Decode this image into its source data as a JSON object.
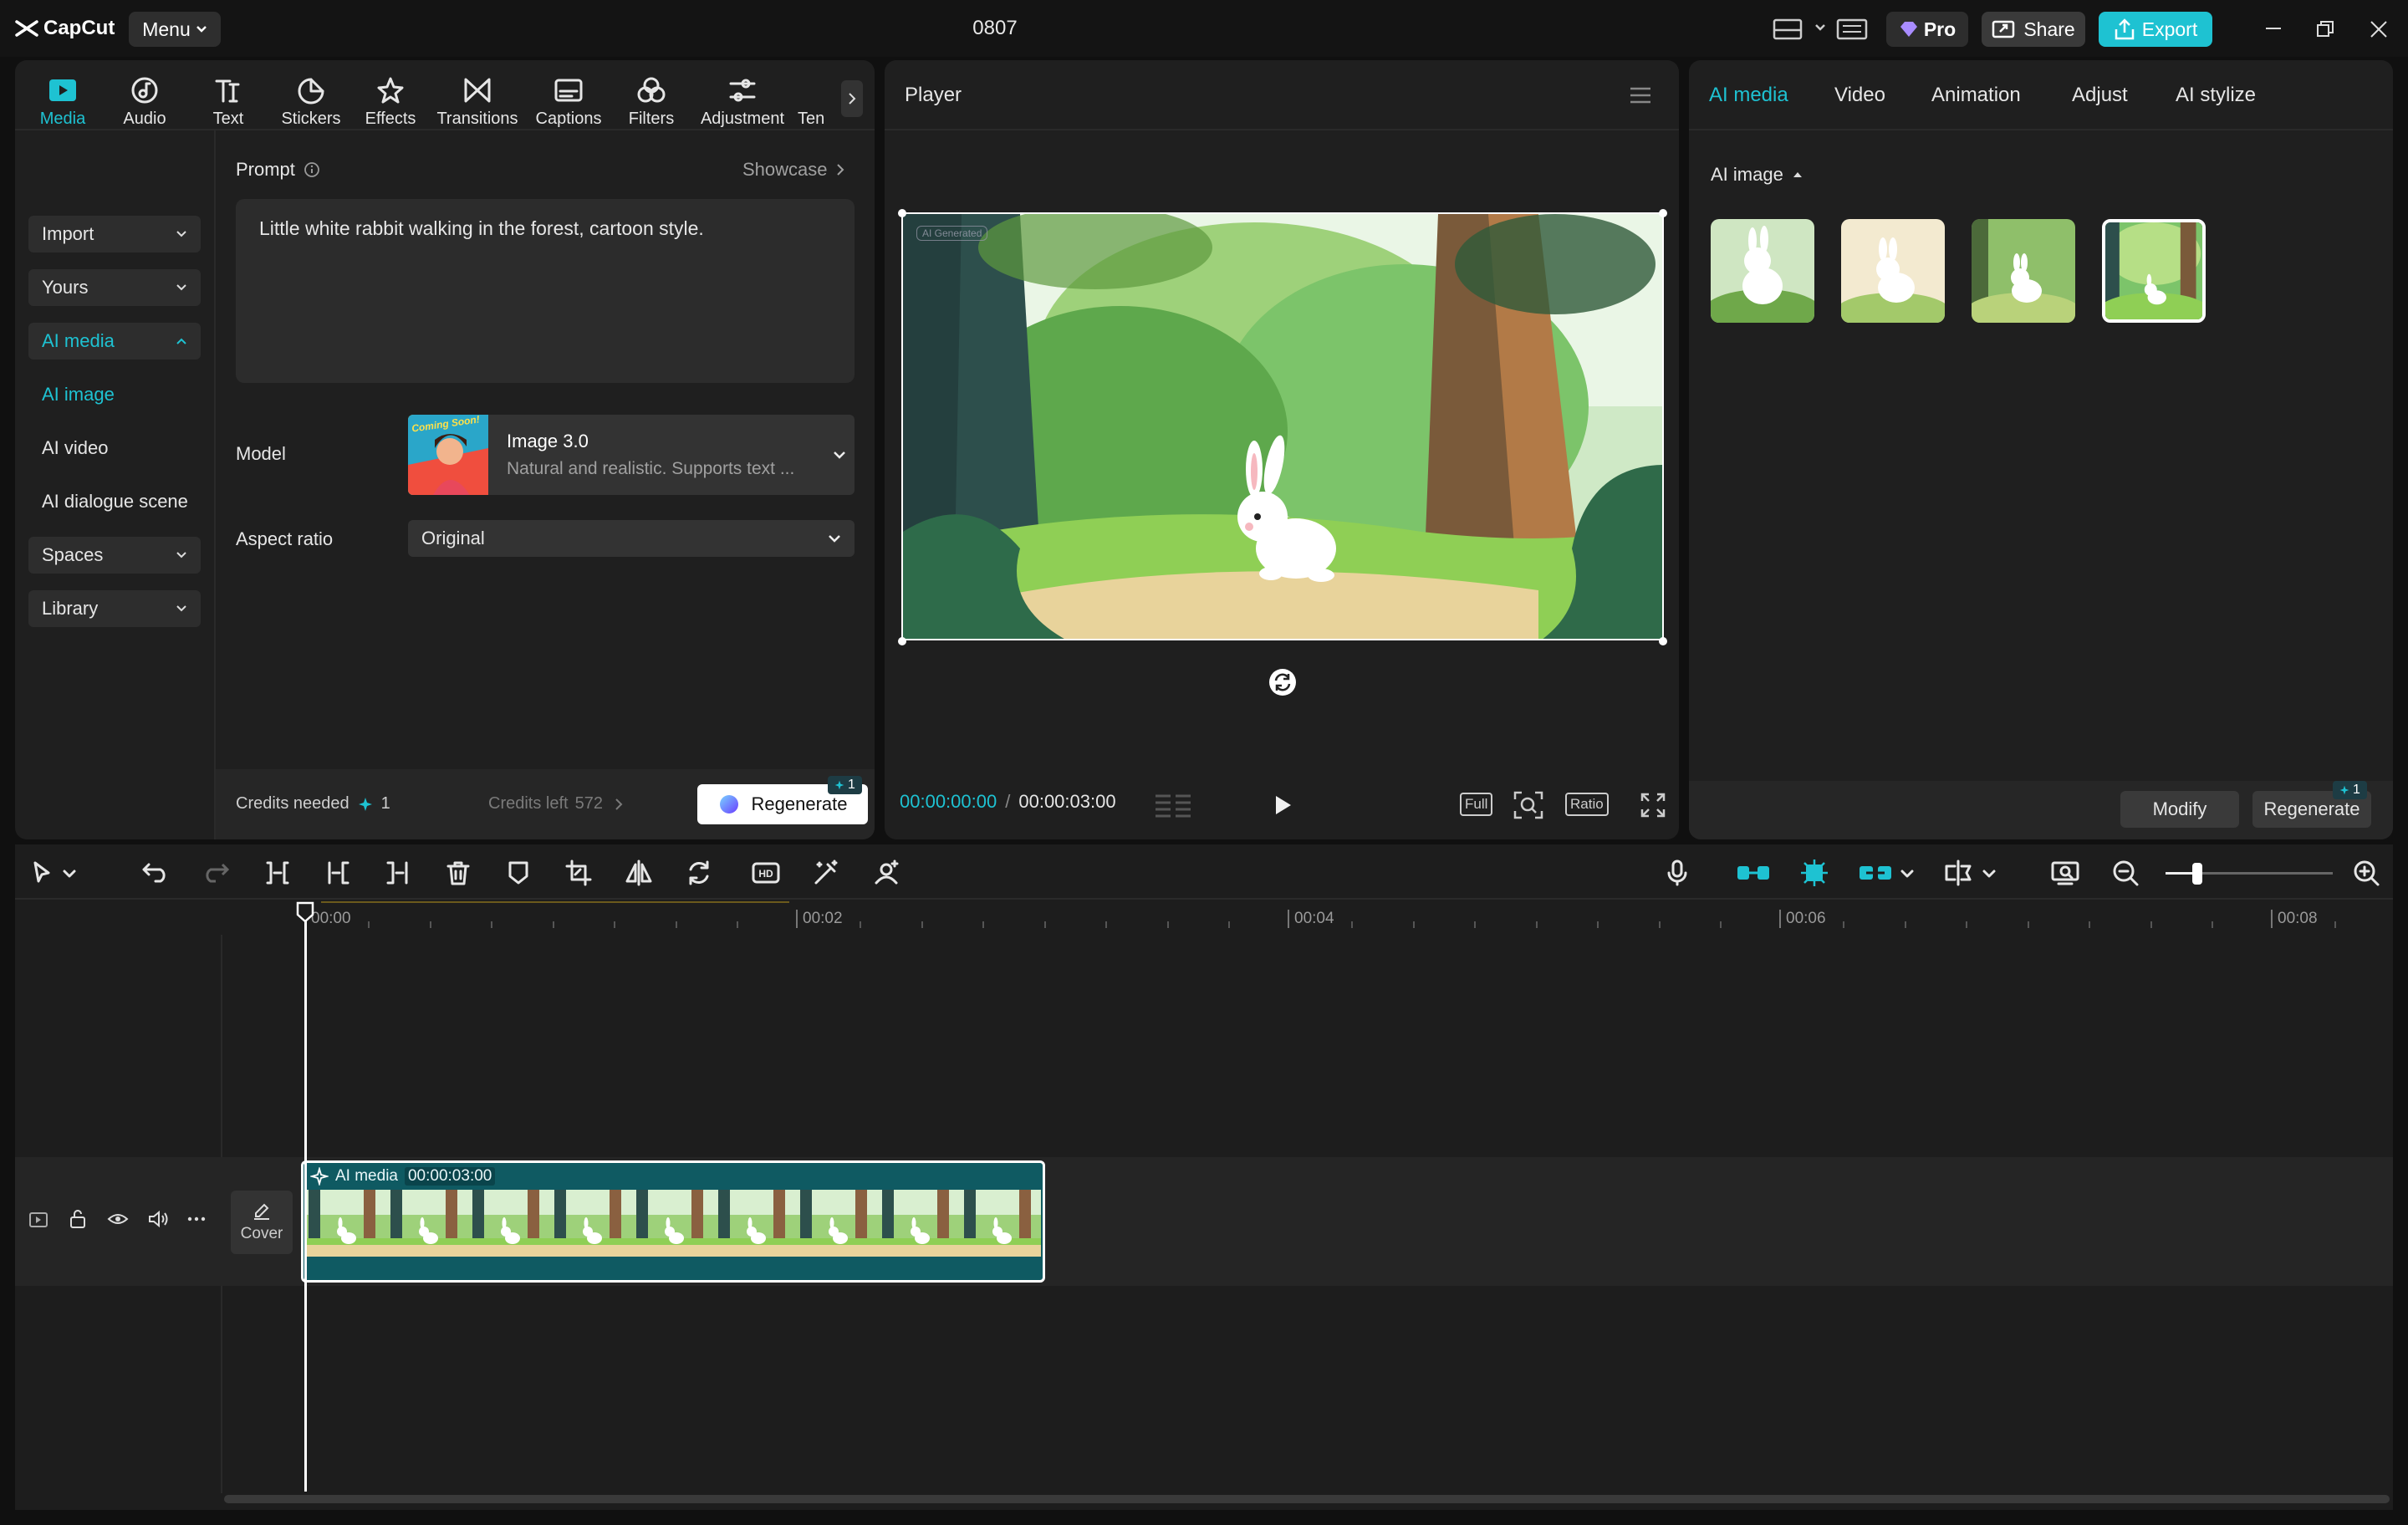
{
  "titlebar": {
    "app_name": "CapCut",
    "menu_label": "Menu",
    "project_title": "0807",
    "pro_label": "Pro",
    "share_label": "Share",
    "export_label": "Export"
  },
  "toolbar": {
    "tabs": [
      {
        "label": "Media",
        "icon": "media-icon",
        "active": true
      },
      {
        "label": "Audio",
        "icon": "audio-icon"
      },
      {
        "label": "Text",
        "icon": "text-icon"
      },
      {
        "label": "Stickers",
        "icon": "stickers-icon"
      },
      {
        "label": "Effects",
        "icon": "effects-icon"
      },
      {
        "label": "Transitions",
        "icon": "transitions-icon"
      },
      {
        "label": "Captions",
        "icon": "captions-icon"
      },
      {
        "label": "Filters",
        "icon": "filters-icon"
      },
      {
        "label": "Adjustment",
        "icon": "adjustment-icon"
      },
      {
        "label": "Ten",
        "icon": "templates-icon"
      }
    ]
  },
  "media_sidebar": {
    "import": "Import",
    "yours": "Yours",
    "ai_media": "AI media",
    "ai_image": "AI image",
    "ai_video": "AI video",
    "ai_dialogue": "AI dialogue scene",
    "spaces": "Spaces",
    "library": "Library"
  },
  "prompt_panel": {
    "prompt_label": "Prompt",
    "showcase_label": "Showcase",
    "prompt_text": "Little white rabbit walking in the forest, cartoon style.",
    "model_label": "Model",
    "model_badge": "Coming Soon!",
    "model_name": "Image 3.0",
    "model_desc": "Natural and realistic. Supports text ...",
    "aspect_label": "Aspect ratio",
    "aspect_value": "Original",
    "credits_needed_label": "Credits needed",
    "credits_needed_value": "1",
    "credits_left_label": "Credits left",
    "credits_left_value": "572",
    "regenerate_label": "Regenerate",
    "regenerate_badge": "1"
  },
  "player": {
    "title": "Player",
    "watermark": "AI Generated",
    "current_time": "00:00:00:00",
    "separator": "/",
    "total_time": "00:00:03:00",
    "full_label": "Full",
    "ratio_label": "Ratio"
  },
  "right_panel": {
    "tabs": [
      "AI media",
      "Video",
      "Animation",
      "Adjust",
      "AI stylize"
    ],
    "section_label": "AI image",
    "modify_label": "Modify",
    "regenerate_label": "Regenerate",
    "regenerate_badge": "1"
  },
  "timeline": {
    "ticks": [
      "00:00",
      "00:02",
      "00:04",
      "00:06",
      "00:08"
    ],
    "cover_label": "Cover",
    "clip_label": "AI media",
    "clip_duration": "00:00:03:00"
  },
  "colors": {
    "accent": "#1ec2d2",
    "panel": "#1f1f1f",
    "background": "#101010",
    "clip": "#0f5a62"
  }
}
